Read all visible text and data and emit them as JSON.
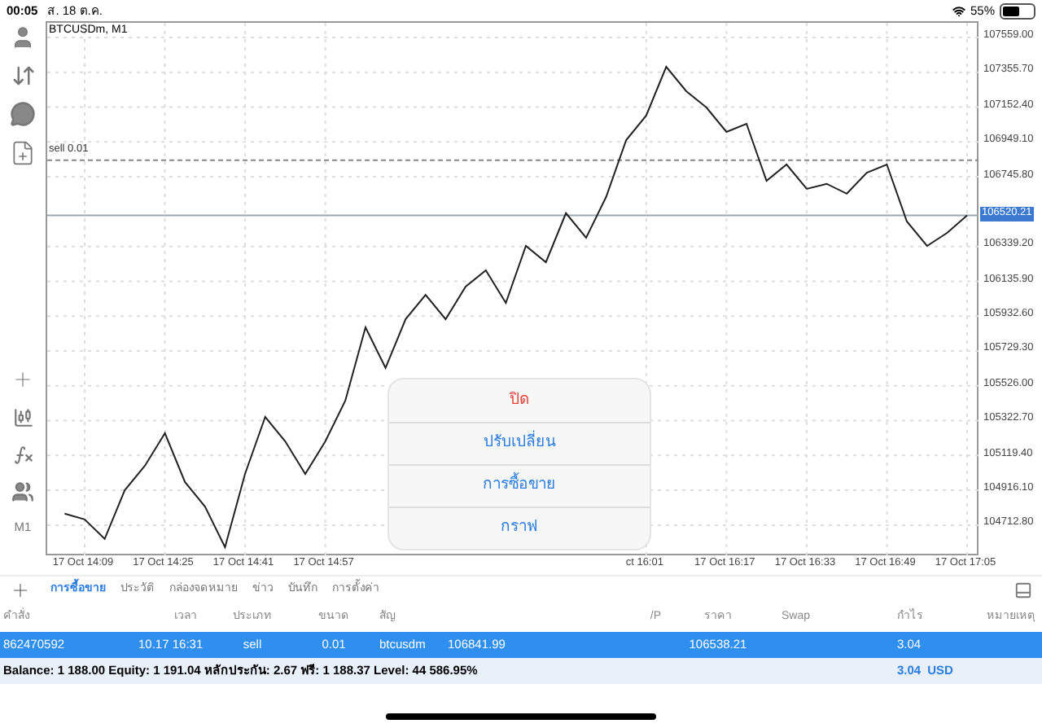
{
  "status_bar": {
    "time": "00:05",
    "date": "ส. 18 ต.ค.",
    "battery": "55%"
  },
  "toolbar": {
    "timeframe": "M1"
  },
  "chart": {
    "title": "BTCUSDm, M1",
    "chart_data": {
      "type": "line",
      "grid": true,
      "categories": [
        null,
        "17 Oct 14:09",
        null,
        null,
        null,
        "17 Oct 14:25",
        null,
        null,
        null,
        "17 Oct 14:41",
        null,
        null,
        null,
        "17 Oct 14:57",
        null,
        null,
        null,
        null,
        null,
        null,
        null,
        null,
        null,
        null,
        null,
        null,
        null,
        null,
        null,
        "ct 16:01",
        null,
        null,
        null,
        "17 Oct 16:17",
        null,
        null,
        null,
        "17 Oct 16:33",
        null,
        null,
        null,
        "17 Oct 16:49",
        null,
        null,
        null,
        "17 Oct 17:05"
      ],
      "series": [
        {
          "color": "#222222",
          "values": [
            104780,
            104746,
            104632,
            104917,
            105059,
            105249,
            104964,
            104822,
            104584,
            105012,
            105344,
            105202,
            105012,
            105202,
            105439,
            105867,
            105630,
            105915,
            106057,
            105915,
            106105,
            106200,
            106010,
            106342,
            106247,
            106533,
            106390,
            106628,
            106960,
            107103,
            107388,
            107245,
            107150,
            107008,
            107055,
            106723,
            106818,
            106675,
            106704,
            106647,
            106770,
            106818,
            106485,
            106342,
            106418,
            106520
          ]
        }
      ],
      "ylim": [
        104536.4,
        107644.5
      ],
      "yticks": [
        {
          "value": 107559.0,
          "label": "107559.00"
        },
        {
          "value": 107355.7,
          "label": "107355.70"
        },
        {
          "value": 107152.4,
          "label": "107152.40"
        },
        {
          "value": 106949.1,
          "label": "106949.10"
        },
        {
          "value": 106745.8,
          "label": "106745.80"
        },
        {
          "value": 106339.2,
          "label": "106339.20"
        },
        {
          "value": 106135.9,
          "label": "106135.90"
        },
        {
          "value": 105932.6,
          "label": "105932.60"
        },
        {
          "value": 105729.3,
          "label": "105729.30"
        },
        {
          "value": 105526.0,
          "label": "105526.00"
        },
        {
          "value": 105322.7,
          "label": "105322.70"
        },
        {
          "value": 105119.4,
          "label": "105119.40"
        },
        {
          "value": 104916.1,
          "label": "104916.10"
        },
        {
          "value": 104712.8,
          "label": "104712.80"
        }
      ],
      "ref_lines": [
        {
          "axis": "y",
          "value": 106841.99,
          "label": "sell 0.01"
        },
        {
          "axis": "y",
          "value": 106520.21,
          "label": "106520.21"
        }
      ]
    }
  },
  "tabs": [
    {
      "label": "การซื้อขาย",
      "selected": true
    },
    {
      "label": "ประวัติ",
      "selected": false
    },
    {
      "label": "กล่องจดหมาย",
      "selected": false
    },
    {
      "label": "ข่าว",
      "selected": false
    },
    {
      "label": "บันทึก",
      "selected": false
    },
    {
      "label": "การตั้งค่า",
      "selected": false
    }
  ],
  "table": {
    "columns": [
      "คำสั่ง",
      "เวลา",
      "ประเภท",
      "ขนาด",
      "สัญ",
      "",
      "",
      "/P",
      "ราคา",
      "Swap",
      "กำไร",
      "หมายเหตุ"
    ],
    "rows": [
      {
        "selected": true,
        "cells": [
          "862470592",
          "10.17 16:31",
          "sell",
          "0.01",
          "btcusdm",
          "106841.99",
          "",
          "",
          "106538.21",
          "",
          "3.04",
          ""
        ]
      }
    ]
  },
  "summary": {
    "text": "Balance: 1 188.00 Equity: 1 191.04 หลักประกัน: 2.67 ฟรี: 1 188.37 Level: 44 586.95%",
    "profit": "3.04",
    "currency": "USD"
  },
  "action_menu": [
    {
      "label": "ปิด",
      "kind": "destructive"
    },
    {
      "label": "ปรับเปลี่ยน",
      "kind": "default"
    },
    {
      "label": "การซื้อขาย",
      "kind": "default"
    },
    {
      "label": "กราฟ",
      "kind": "default"
    }
  ]
}
